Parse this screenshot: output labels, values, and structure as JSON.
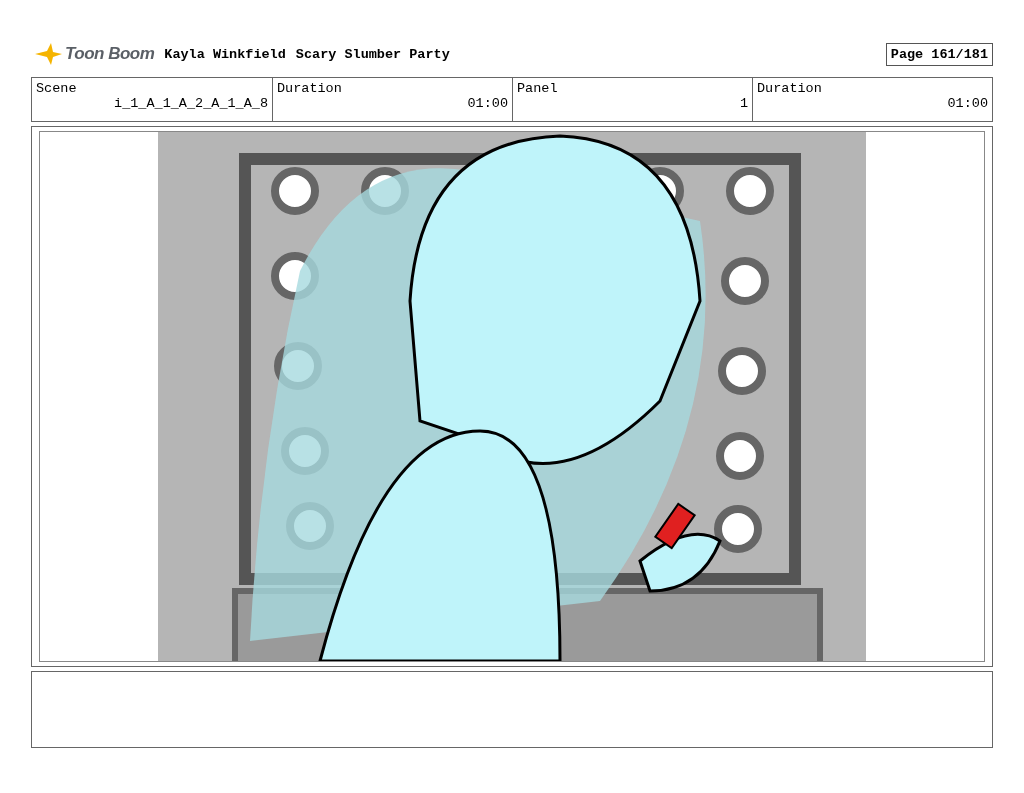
{
  "header": {
    "logo": "Toon Boom",
    "author": "Kayla Winkfield",
    "title": "Scary Slumber Party",
    "page": "Page 161/181"
  },
  "info_table": {
    "columns": [
      "Scene",
      "Duration",
      "Panel",
      "Duration"
    ],
    "rows": [
      [
        "i_1_A_1_A_2_A_1_A_8",
        "01:00",
        "1",
        "01:00"
      ]
    ]
  }
}
